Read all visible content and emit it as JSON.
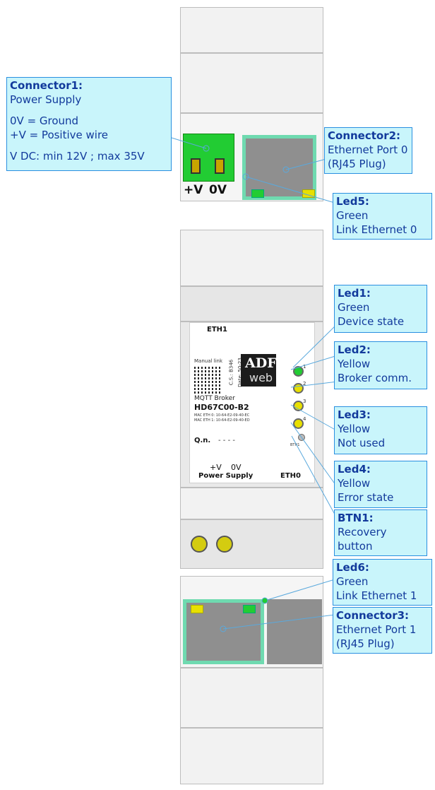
{
  "device": {
    "top_power_labels": {
      "plus": "+V",
      "zero": "0V"
    },
    "panel": {
      "eth1_label": "ETH1",
      "manual_link": "Manual link",
      "cs_label": "C.S.: B346",
      "date_label": "Date: 50-23",
      "brand_top": "ADF",
      "brand_bottom": "web",
      "product_type": "MQTT Broker",
      "model": "HD67C00-B2",
      "mac0": "MAC ETH 0: 10-64-E2-09-40-EC",
      "mac1": "MAC ETH 1: 10-64-E2-09-40-ED",
      "qn_label": "Q.n.",
      "qn_value": "- - - -",
      "pwr_plus": "+V",
      "pwr_zero": "0V",
      "power_supply": "Power Supply",
      "eth0_label": "ETH0",
      "led_nums": [
        "1",
        "2",
        "3",
        "4"
      ],
      "btn_label": "BTN1"
    },
    "led_colors": {
      "green": "#22cc33",
      "yellow": "#e8e000",
      "off": "#dddddd"
    }
  },
  "callouts": {
    "connector1": {
      "title": "Connector1:",
      "lines": [
        "Power Supply",
        "",
        "0V = Ground",
        "+V = Positive wire",
        "",
        "V DC: min 12V ; max 35V"
      ]
    },
    "connector2": {
      "title": "Connector2:",
      "lines": [
        "Ethernet Port 0",
        "(RJ45 Plug)"
      ]
    },
    "led5": {
      "title": "Led5:",
      "lines": [
        "Green",
        "Link Ethernet 0"
      ]
    },
    "led1": {
      "title": "Led1:",
      "lines": [
        "Green",
        "Device state"
      ]
    },
    "led2": {
      "title": "Led2:",
      "lines": [
        "Yellow",
        "Broker comm."
      ]
    },
    "led3": {
      "title": "Led3:",
      "lines": [
        "Yellow",
        "Not used"
      ]
    },
    "led4": {
      "title": "Led4:",
      "lines": [
        "Yellow",
        "Error state"
      ]
    },
    "btn1": {
      "title": "BTN1:",
      "lines": [
        "Recovery",
        "button"
      ]
    },
    "led6": {
      "title": "Led6:",
      "lines": [
        "Green",
        "Link Ethernet 1"
      ]
    },
    "connector3": {
      "title": "Connector3:",
      "lines": [
        "Ethernet Port 1",
        "(RJ45 Plug)"
      ]
    }
  }
}
